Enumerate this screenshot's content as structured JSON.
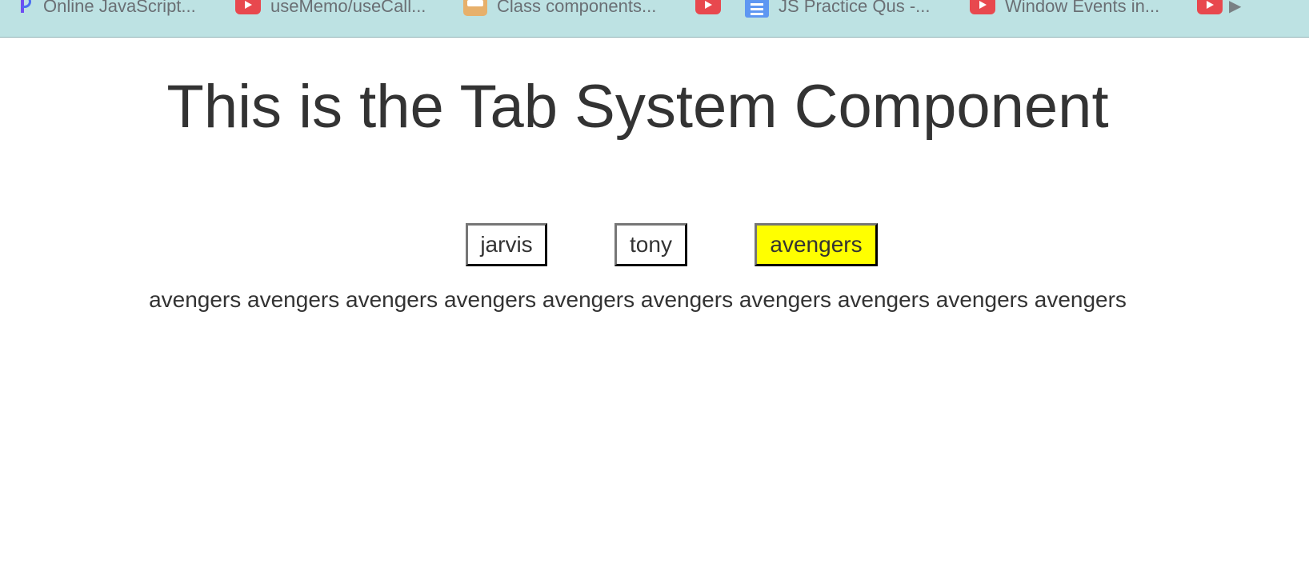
{
  "bookmarks": [
    {
      "icon": "p-logo-icon",
      "label": "Online JavaScript..."
    },
    {
      "icon": "youtube-icon",
      "label": "useMemo/useCall..."
    },
    {
      "icon": "robot-icon",
      "label": "Class components..."
    },
    {
      "icon": "youtube-icon",
      "label": ""
    },
    {
      "icon": "docs-icon",
      "label": "JS Practice Qus -..."
    },
    {
      "icon": "youtube-icon",
      "label": "Window Events in..."
    },
    {
      "icon": "youtube-icon",
      "label": "▶"
    }
  ],
  "page": {
    "title": "This is the Tab System Component"
  },
  "tabs": [
    {
      "label": "jarvis",
      "active": false
    },
    {
      "label": "tony",
      "active": false
    },
    {
      "label": "avengers",
      "active": true
    }
  ],
  "content": {
    "text": "avengers avengers avengers avengers avengers avengers avengers avengers avengers avengers"
  },
  "colors": {
    "bookmarks_bar_bg": "#bde2e3",
    "active_tab_bg": "#ffff00",
    "youtube_red": "#e8484e",
    "docs_blue": "#5e97f2"
  }
}
